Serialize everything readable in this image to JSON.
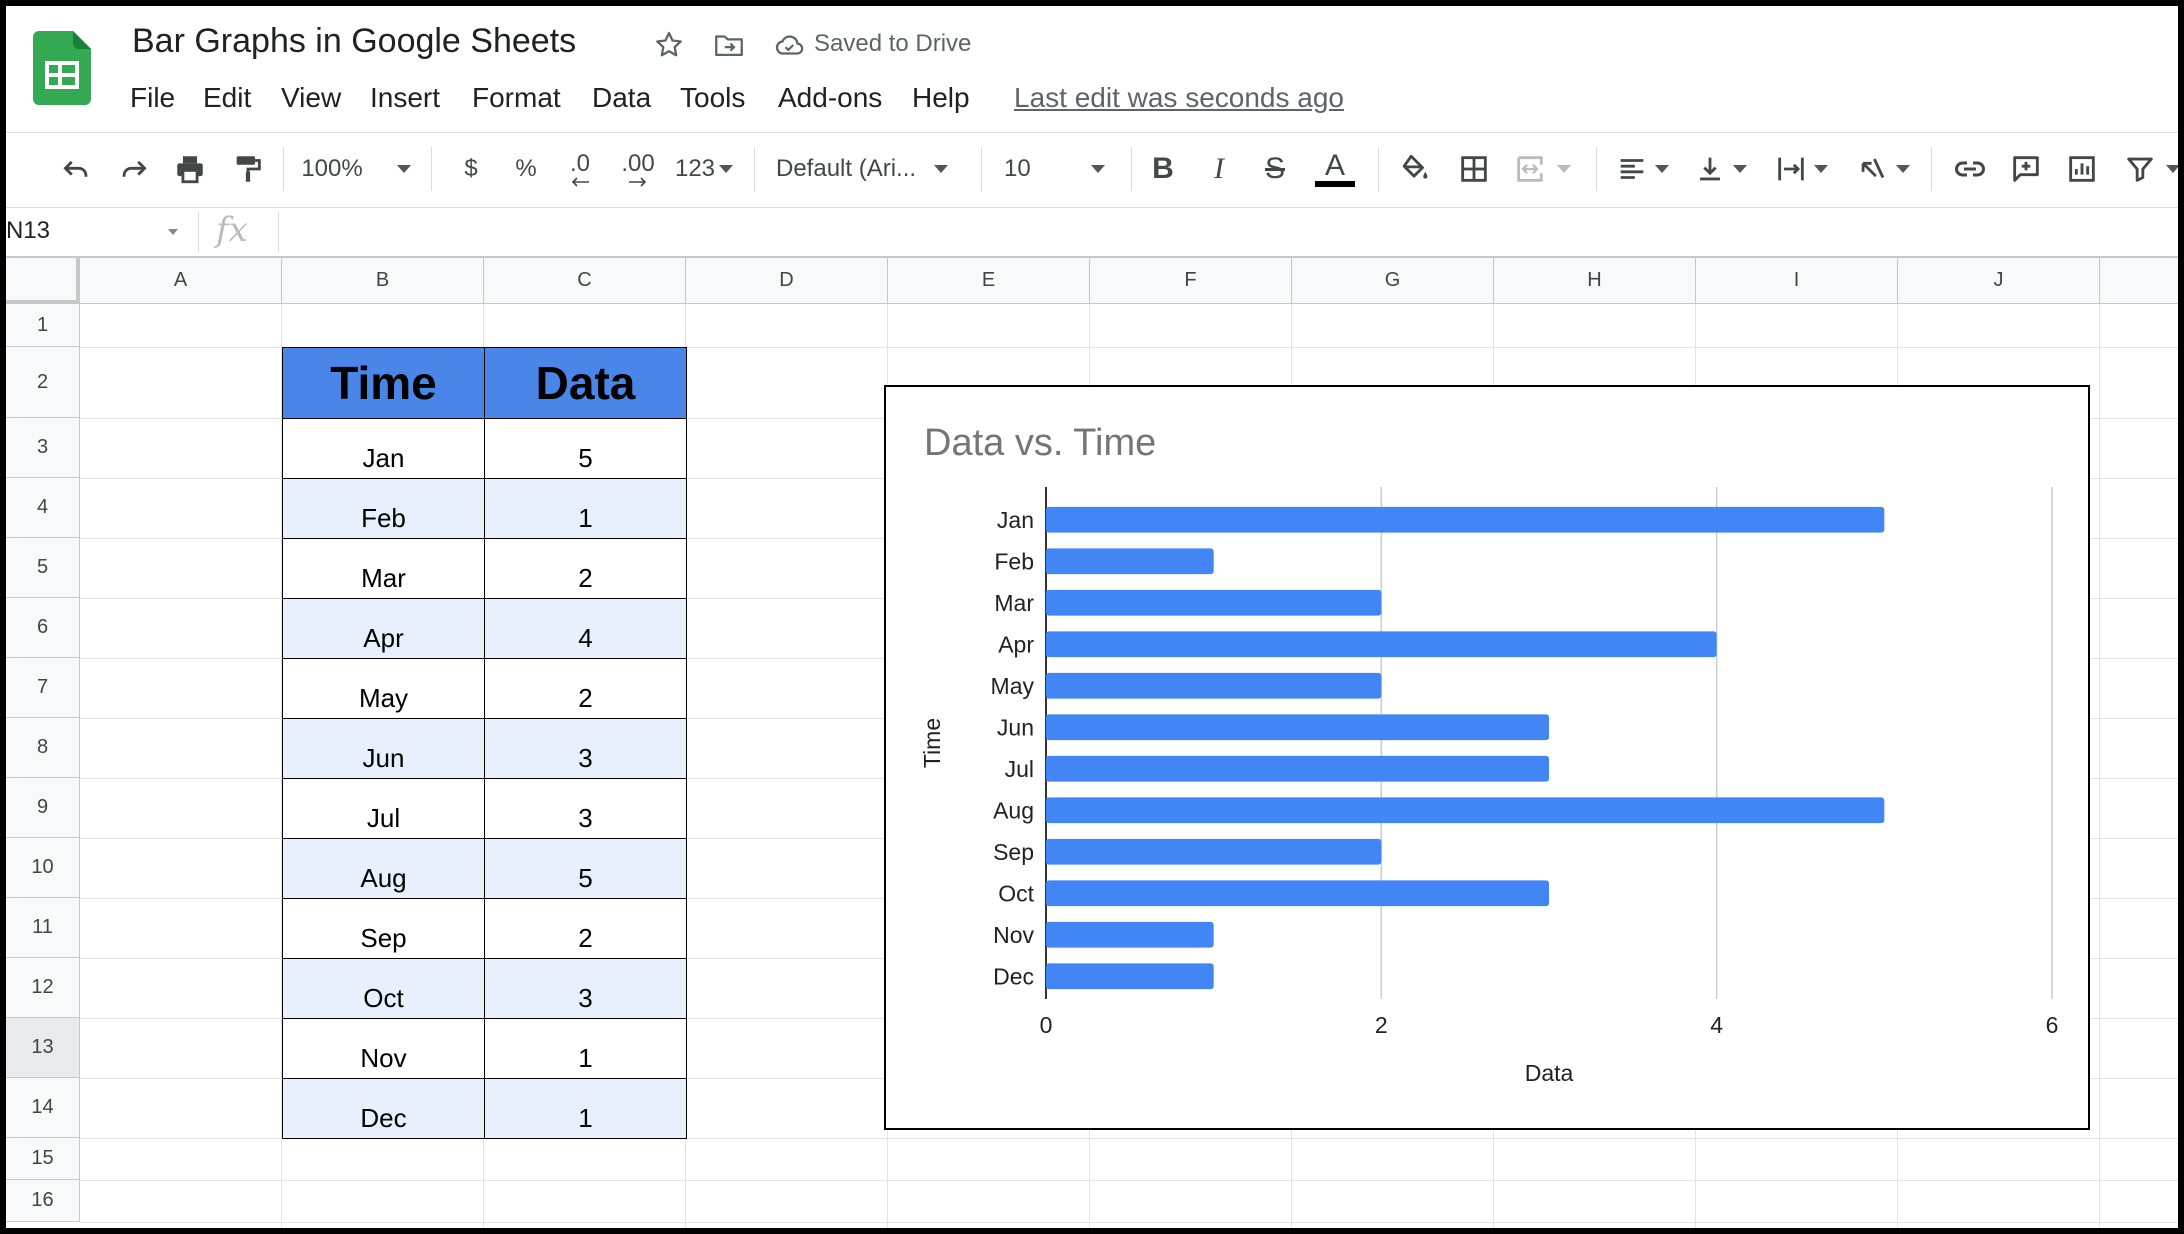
{
  "header": {
    "title": "Bar Graphs in Google Sheets",
    "saved_status": "Saved to Drive",
    "last_edit": "Last edit was seconds ago",
    "menu": [
      "File",
      "Edit",
      "View",
      "Insert",
      "Format",
      "Data",
      "Tools",
      "Add-ons",
      "Help"
    ]
  },
  "toolbar": {
    "zoom": "100%",
    "currency": "$",
    "percent": "%",
    "dec_decrease": ".0",
    "dec_increase": ".00",
    "more_formats": "123",
    "font": "Default (Ari...",
    "font_size": "10",
    "bold": "B",
    "italic": "I",
    "strike": "S",
    "text_color": "A",
    "text_color_value": "#000000"
  },
  "formula_bar": {
    "name_box": "N13",
    "fx": "fx",
    "value": ""
  },
  "grid": {
    "columns": [
      "A",
      "B",
      "C",
      "D",
      "E",
      "F",
      "G",
      "H",
      "I",
      "J"
    ],
    "rows": [
      "1",
      "2",
      "3",
      "4",
      "5",
      "6",
      "7",
      "8",
      "9",
      "10",
      "11",
      "12",
      "13",
      "14",
      "15",
      "16"
    ],
    "selected_row": "13"
  },
  "table": {
    "headers": [
      "Time",
      "Data"
    ],
    "rows": [
      {
        "time": "Jan",
        "data": "5"
      },
      {
        "time": "Feb",
        "data": "1"
      },
      {
        "time": "Mar",
        "data": "2"
      },
      {
        "time": "Apr",
        "data": "4"
      },
      {
        "time": "May",
        "data": "2"
      },
      {
        "time": "Jun",
        "data": "3"
      },
      {
        "time": "Jul",
        "data": "3"
      },
      {
        "time": "Aug",
        "data": "5"
      },
      {
        "time": "Sep",
        "data": "2"
      },
      {
        "time": "Oct",
        "data": "3"
      },
      {
        "time": "Nov",
        "data": "1"
      },
      {
        "time": "Dec",
        "data": "1"
      }
    ],
    "header_color": "#4a86e8",
    "band_color": "#e8f0fe"
  },
  "chart_data": {
    "type": "bar",
    "orientation": "horizontal",
    "title": "Data vs. Time",
    "xlabel": "Data",
    "ylabel": "Time",
    "categories": [
      "Jan",
      "Feb",
      "Mar",
      "Apr",
      "May",
      "Jun",
      "Jul",
      "Aug",
      "Sep",
      "Oct",
      "Nov",
      "Dec"
    ],
    "values": [
      5,
      1,
      2,
      4,
      2,
      3,
      3,
      5,
      2,
      3,
      1,
      1
    ],
    "xlim": [
      0,
      6
    ],
    "xticks": [
      "0",
      "2",
      "4",
      "6"
    ],
    "grid": true,
    "bar_color": "#4285f4"
  }
}
